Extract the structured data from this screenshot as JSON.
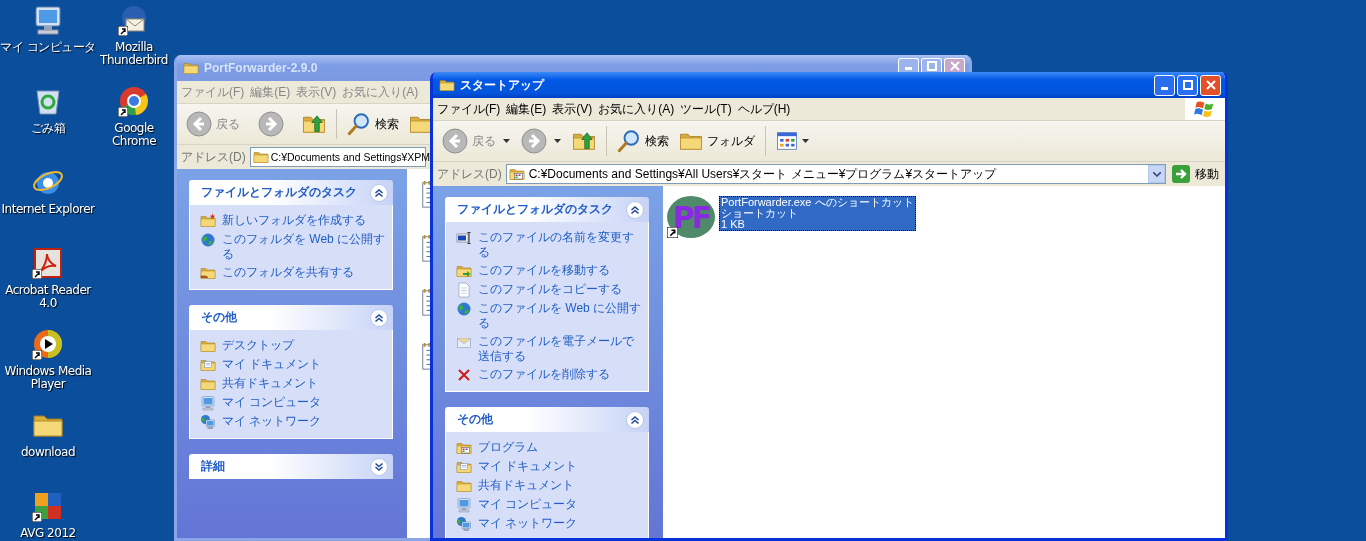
{
  "desktop_columns": [
    {
      "icons": [
        {
          "label": "マイ コンピュータ",
          "kind": "computer",
          "shortcut": false
        },
        {
          "label": "ごみ箱",
          "kind": "bin",
          "shortcut": false
        },
        {
          "label": "Internet Explorer",
          "kind": "ie",
          "shortcut": false
        },
        {
          "label": "Acrobat Reader 4.0",
          "kind": "acrobat",
          "shortcut": true
        },
        {
          "label": "Windows Media Player",
          "kind": "wmp",
          "shortcut": true
        },
        {
          "label": "download",
          "kind": "folder",
          "shortcut": false
        },
        {
          "label": "AVG 2012",
          "kind": "avg",
          "shortcut": true
        }
      ]
    },
    {
      "icons": [
        {
          "label": "Mozilla Thunderbird",
          "kind": "mail",
          "shortcut": true
        },
        {
          "label": "Google Chrome",
          "kind": "chrome",
          "shortcut": true
        }
      ]
    }
  ],
  "windows": [
    {
      "title": "PortForwarder-2.9.0",
      "active": false,
      "menu": [
        "ファイル(F)",
        "編集(E)",
        "表示(V)",
        "お気に入り(A)"
      ],
      "toolbar": {
        "back": "戻る",
        "search": "検索"
      },
      "address": {
        "label": "アドレス(D)",
        "value": "C:¥Documents and Settings¥XPM"
      },
      "task_panels": [
        {
          "title": "ファイルとフォルダのタスク",
          "expanded": true,
          "items": [
            {
              "label": "新しいフォルダを作成する",
              "kind": "newfolder"
            },
            {
              "label": "このフォルダを Web に公開する",
              "kind": "globe"
            },
            {
              "label": "このフォルダを共有する",
              "kind": "sharefolder"
            }
          ]
        },
        {
          "title": "その他",
          "expanded": true,
          "items": [
            {
              "label": "デスクトップ",
              "kind": "folder"
            },
            {
              "label": "マイ ドキュメント",
              "kind": "docsfolder"
            },
            {
              "label": "共有ドキュメント",
              "kind": "folder"
            },
            {
              "label": "マイ コンピュータ",
              "kind": "computer"
            },
            {
              "label": "マイ ネットワーク",
              "kind": "network"
            }
          ]
        },
        {
          "title": "詳細",
          "expanded": false
        }
      ]
    },
    {
      "title": "スタートアップ",
      "active": true,
      "menu": [
        "ファイル(F)",
        "編集(E)",
        "表示(V)",
        "お気に入り(A)",
        "ツール(T)",
        "ヘルプ(H)"
      ],
      "toolbar": {
        "back": "戻る",
        "search": "検索",
        "folders": "フォルダ"
      },
      "address": {
        "label": "アドレス(D)",
        "value": "C:¥Documents and Settings¥All Users¥スタート メニュー¥プログラム¥スタートアップ",
        "go": "移動"
      },
      "task_panels": [
        {
          "title": "ファイルとフォルダのタスク",
          "expanded": true,
          "items": [
            {
              "label": "このファイルの名前を変更する",
              "kind": "rename"
            },
            {
              "label": "このファイルを移動する",
              "kind": "move"
            },
            {
              "label": "このファイルをコピーする",
              "kind": "document"
            },
            {
              "label": "このファイルを Web に公開する",
              "kind": "globe"
            },
            {
              "label": "このファイルを電子メールで送信する",
              "kind": "email"
            },
            {
              "label": "このファイルを削除する",
              "kind": "delete"
            }
          ]
        },
        {
          "title": "その他",
          "expanded": true,
          "items": [
            {
              "label": "プログラム",
              "kind": "programs"
            },
            {
              "label": "マイ ドキュメント",
              "kind": "docsfolder"
            },
            {
              "label": "共有ドキュメント",
              "kind": "folder"
            },
            {
              "label": "マイ コンピュータ",
              "kind": "computer"
            },
            {
              "label": "マイ ネットワーク",
              "kind": "network"
            }
          ]
        }
      ],
      "files": [
        {
          "logo": "PF",
          "name": "PortForwarder.exe へのショートカット",
          "type": "ショートカット",
          "size": "1 KB",
          "selected": true,
          "shortcut": true
        }
      ]
    }
  ]
}
